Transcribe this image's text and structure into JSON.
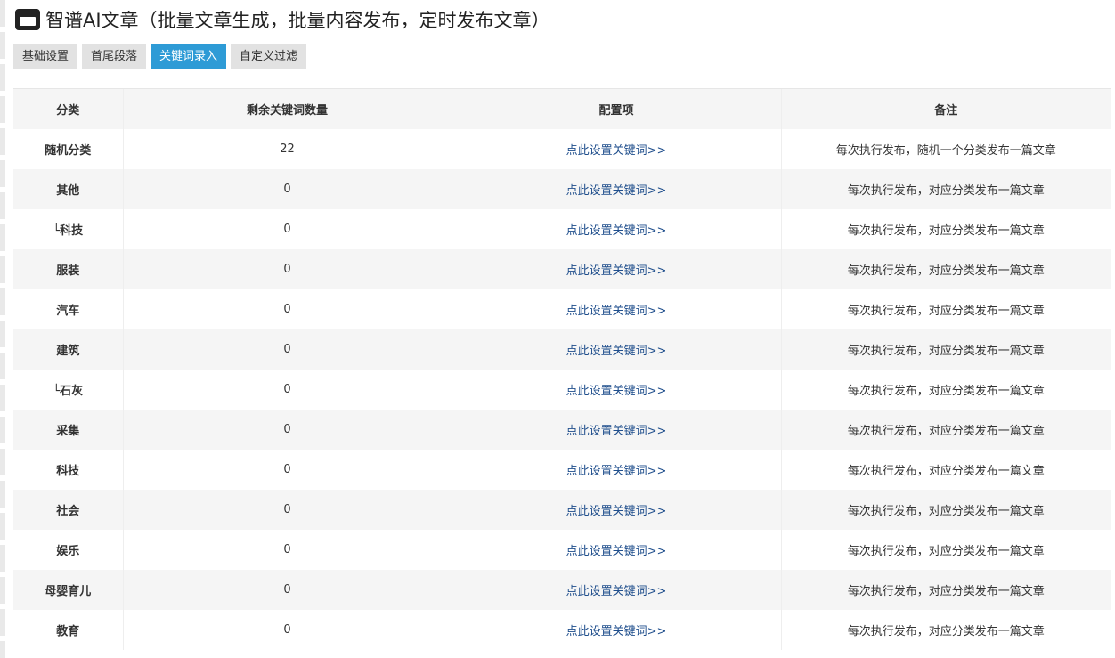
{
  "header": {
    "title": "智谱AI文章（批量文章生成，批量内容发布，定时发布文章）"
  },
  "tabs": [
    {
      "label": "基础设置",
      "active": false
    },
    {
      "label": "首尾段落",
      "active": false
    },
    {
      "label": "关键词录入",
      "active": true
    },
    {
      "label": "自定义过滤",
      "active": false
    }
  ],
  "table": {
    "headers": [
      "分类",
      "剩余关键词数量",
      "配置项",
      "备注"
    ],
    "rows": [
      {
        "category": "随机分类",
        "count": "22",
        "config": "点此设置关键词>>",
        "note": "每次执行发布，随机一个分类发布一篇文章"
      },
      {
        "category": "其他",
        "count": "0",
        "config": "点此设置关键词>>",
        "note": "每次执行发布，对应分类发布一篇文章"
      },
      {
        "category": "└科技",
        "count": "0",
        "config": "点此设置关键词>>",
        "note": "每次执行发布，对应分类发布一篇文章"
      },
      {
        "category": "服装",
        "count": "0",
        "config": "点此设置关键词>>",
        "note": "每次执行发布，对应分类发布一篇文章"
      },
      {
        "category": "汽车",
        "count": "0",
        "config": "点此设置关键词>>",
        "note": "每次执行发布，对应分类发布一篇文章"
      },
      {
        "category": "建筑",
        "count": "0",
        "config": "点此设置关键词>>",
        "note": "每次执行发布，对应分类发布一篇文章"
      },
      {
        "category": "└石灰",
        "count": "0",
        "config": "点此设置关键词>>",
        "note": "每次执行发布，对应分类发布一篇文章"
      },
      {
        "category": "采集",
        "count": "0",
        "config": "点此设置关键词>>",
        "note": "每次执行发布，对应分类发布一篇文章"
      },
      {
        "category": "科技",
        "count": "0",
        "config": "点此设置关键词>>",
        "note": "每次执行发布，对应分类发布一篇文章"
      },
      {
        "category": "社会",
        "count": "0",
        "config": "点此设置关键词>>",
        "note": "每次执行发布，对应分类发布一篇文章"
      },
      {
        "category": "娱乐",
        "count": "0",
        "config": "点此设置关键词>>",
        "note": "每次执行发布，对应分类发布一篇文章"
      },
      {
        "category": "母婴育儿",
        "count": "0",
        "config": "点此设置关键词>>",
        "note": "每次执行发布，对应分类发布一篇文章"
      },
      {
        "category": "教育",
        "count": "0",
        "config": "点此设置关键词>>",
        "note": "每次执行发布，对应分类发布一篇文章"
      }
    ]
  },
  "colors": {
    "accent": "#2e9bd6",
    "link": "#1f4e8c",
    "tab_bg": "#e2e2e2"
  },
  "icons": {
    "header": "window-icon"
  }
}
